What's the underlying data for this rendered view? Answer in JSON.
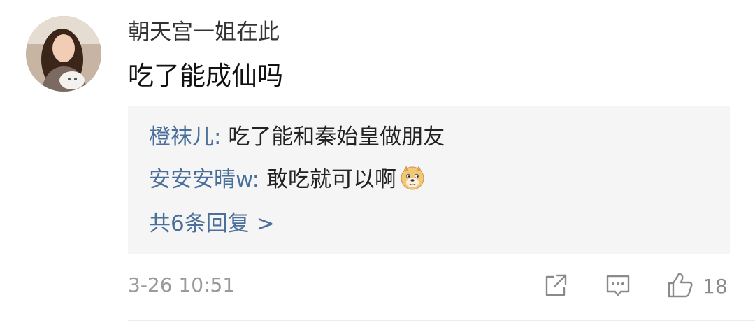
{
  "comment": {
    "username": "朝天宫一姐在此",
    "text": "吃了能成仙吗",
    "time": "3-26 10:51",
    "like_count": "18"
  },
  "replies": [
    {
      "user": "橙袜儿",
      "separator": ": ",
      "text": "吃了能和秦始皇做朋友"
    },
    {
      "user": "安安安晴w",
      "separator": ": ",
      "text": "敢吃就可以啊",
      "emoji": "doge-emoji"
    }
  ],
  "reply_summary": "共6条回复 >",
  "icons": {
    "share": "share-icon",
    "reply": "comment-icon",
    "like": "thumbs-up-icon"
  },
  "colors": {
    "username": "#333333",
    "reply_user": "#4a6f9b",
    "reply_background": "#f5f5f5",
    "meta_gray": "#9a9a9a"
  }
}
